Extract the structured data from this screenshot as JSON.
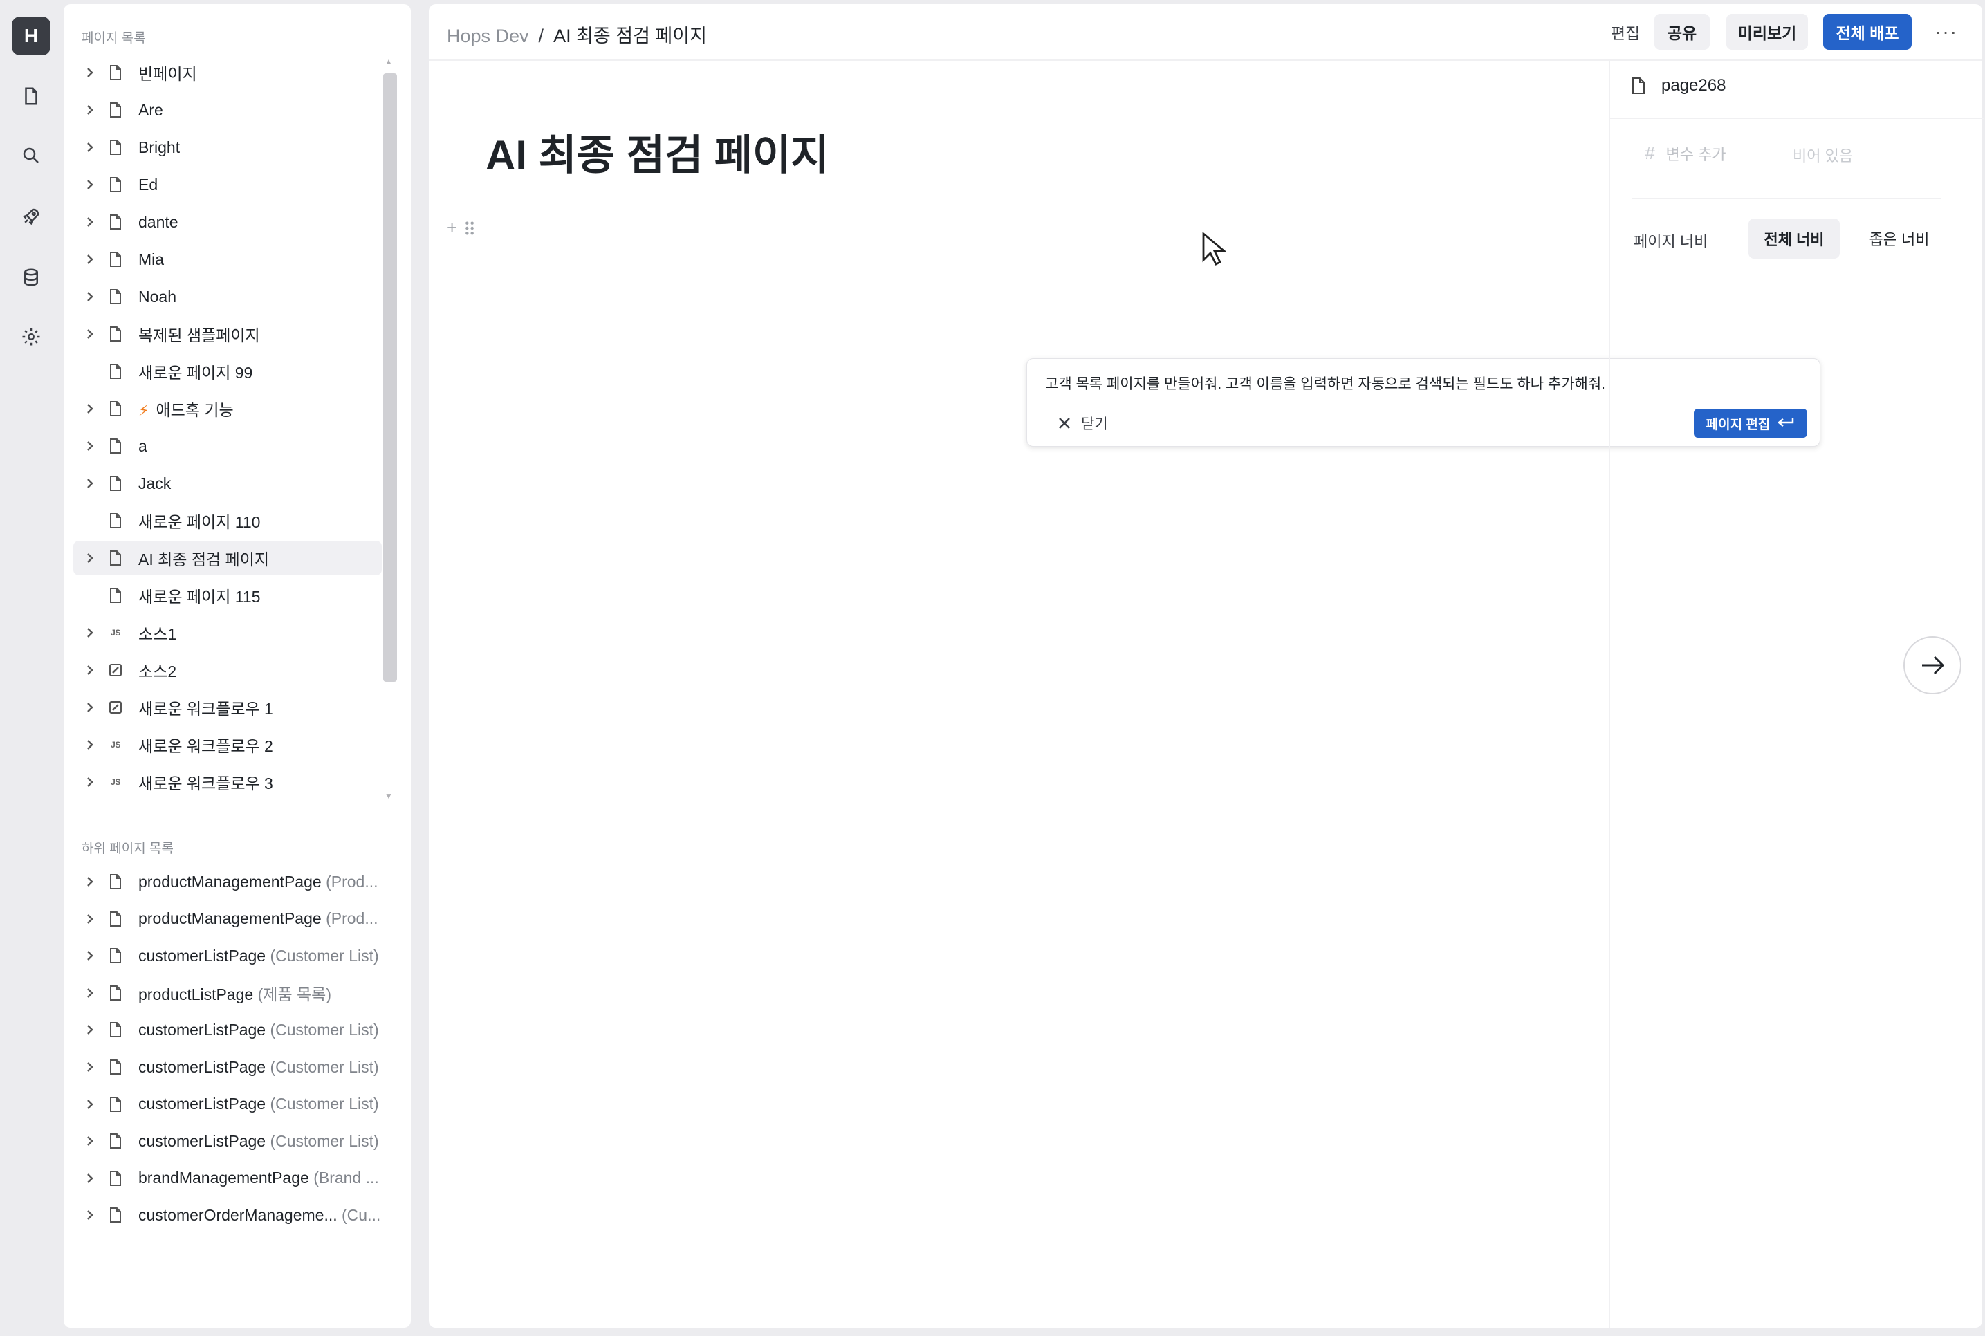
{
  "rail": {
    "logo": "H",
    "icons": [
      "file-icon",
      "search-icon",
      "rocket-icon",
      "database-icon",
      "settings-icon"
    ]
  },
  "tree": {
    "section_label": "페이지 목록",
    "items": [
      {
        "label": "빈페이지",
        "icon": "page",
        "expandable": true
      },
      {
        "label": "Are",
        "icon": "page",
        "expandable": true
      },
      {
        "label": "Bright",
        "icon": "page",
        "expandable": true
      },
      {
        "label": "Ed",
        "icon": "page",
        "expandable": true
      },
      {
        "label": "dante",
        "icon": "page",
        "expandable": true
      },
      {
        "label": "Mia",
        "icon": "page",
        "expandable": true
      },
      {
        "label": "Noah",
        "icon": "page",
        "expandable": true
      },
      {
        "label": "복제된 샘플페이지",
        "icon": "page",
        "expandable": true
      },
      {
        "label": "새로운 페이지 99",
        "icon": "page",
        "expandable": false
      },
      {
        "label": "애드혹 기능",
        "icon": "page",
        "expandable": true,
        "bolt": true
      },
      {
        "label": "a",
        "icon": "page",
        "expandable": true
      },
      {
        "label": "Jack",
        "icon": "page",
        "expandable": true
      },
      {
        "label": "새로운 페이지 110",
        "icon": "page",
        "expandable": false
      },
      {
        "label": "AI 최종 점검 페이지",
        "icon": "page",
        "expandable": true,
        "selected": true
      },
      {
        "label": "새로운 페이지 115",
        "icon": "page",
        "expandable": false
      },
      {
        "label": "소스1",
        "icon": "js",
        "expandable": true
      },
      {
        "label": "소스2",
        "icon": "workflow",
        "expandable": true
      },
      {
        "label": "새로운 워크플로우 1",
        "icon": "workflow",
        "expandable": true
      },
      {
        "label": "새로운 워크플로우 2",
        "icon": "js",
        "expandable": true
      },
      {
        "label": "새로운 워크플로우 3",
        "icon": "js",
        "expandable": true
      }
    ]
  },
  "subtree": {
    "section_label": "하위 페이지 목록",
    "items": [
      {
        "name": "productManagementPage",
        "desc": "(Prod..."
      },
      {
        "name": "productManagementPage",
        "desc": "(Prod..."
      },
      {
        "name": "customerListPage",
        "desc": "(Customer List)"
      },
      {
        "name": "productListPage",
        "desc": "(제품 목록)"
      },
      {
        "name": "customerListPage",
        "desc": "(Customer List)"
      },
      {
        "name": "customerListPage",
        "desc": "(Customer List)"
      },
      {
        "name": "customerListPage",
        "desc": "(Customer List)"
      },
      {
        "name": "customerListPage",
        "desc": "(Customer List)"
      },
      {
        "name": "brandManagementPage",
        "desc": "(Brand ..."
      },
      {
        "name": "customerOrderManageme...",
        "desc": "(Cu..."
      }
    ]
  },
  "header": {
    "breadcrumb_root": "Hops Dev",
    "breadcrumb_sep": "/",
    "breadcrumb_current": "AI 최종 점검 페이지",
    "edit_label": "편집",
    "share_label": "공유",
    "preview_label": "미리보기",
    "deploy_label": "전체 배포",
    "more_label": "···"
  },
  "editor": {
    "title": "AI 최종 점검 페이지",
    "add_block": "+"
  },
  "prompt": {
    "text": "고객 목록 페이지를 만들어줘. 고객 이름을 입력하면 자동으로 검색되는 필드도 하나 추가해줘.",
    "close_label": "닫기",
    "submit_label": "페이지 편집"
  },
  "props": {
    "page_name": "page268",
    "var_hash": "#",
    "var_add": "변수 추가",
    "var_empty": "비어 있음",
    "width_label": "페이지 너비",
    "width_full": "전체 너비",
    "width_narrow": "좁은 너비"
  },
  "colors": {
    "accent": "#2563c9",
    "bolt": "#f07a1a"
  }
}
